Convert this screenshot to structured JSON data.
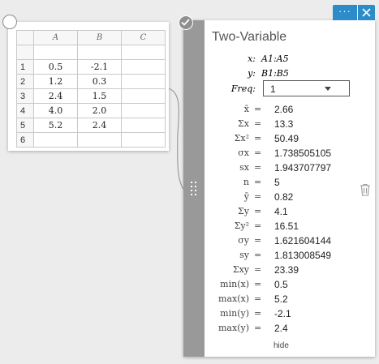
{
  "spreadsheet": {
    "columns": [
      "A",
      "B",
      "C"
    ],
    "rows": [
      {
        "num": "",
        "a": "",
        "b": "",
        "c": ""
      },
      {
        "num": "1",
        "a": "0.5",
        "b": "-2.1",
        "c": ""
      },
      {
        "num": "2",
        "a": "1.2",
        "b": "0.3",
        "c": ""
      },
      {
        "num": "3",
        "a": "2.4",
        "b": "1.5",
        "c": ""
      },
      {
        "num": "4",
        "a": "4.0",
        "b": "2.0",
        "c": ""
      },
      {
        "num": "5",
        "a": "5.2",
        "b": "2.4",
        "c": ""
      },
      {
        "num": "6",
        "a": "",
        "b": "",
        "c": ""
      }
    ]
  },
  "panel": {
    "menu_label": "···",
    "title": "Two-Variable",
    "x_label": "x:",
    "x_range": "A1:A5",
    "y_label": "y:",
    "y_range": "B1:B5",
    "freq_label": "Freq:",
    "freq_value": "1",
    "stats": [
      {
        "label": "x̄",
        "value": "2.66"
      },
      {
        "label": "Σx",
        "value": "13.3"
      },
      {
        "label": "Σx²",
        "value": "50.49"
      },
      {
        "label": "σx",
        "value": "1.738505105"
      },
      {
        "label": "sx",
        "value": "1.943707797"
      },
      {
        "label": "n",
        "value": "5"
      },
      {
        "label": "ȳ",
        "value": "0.82"
      },
      {
        "label": "Σy",
        "value": "4.1"
      },
      {
        "label": "Σy²",
        "value": "16.51"
      },
      {
        "label": "σy",
        "value": "1.621604144"
      },
      {
        "label": "sy",
        "value": "1.813008549"
      },
      {
        "label": "Σxy",
        "value": "23.39"
      },
      {
        "label": "min(x)",
        "value": "0.5"
      },
      {
        "label": "max(x)",
        "value": "5.2"
      },
      {
        "label": "min(y)",
        "value": "-2.1"
      },
      {
        "label": "max(y)",
        "value": "2.4"
      }
    ],
    "equals_sign": "=",
    "hide_label": "hide"
  },
  "colors": {
    "accent": "#2d8bc7",
    "panel_bar": "#999999"
  }
}
